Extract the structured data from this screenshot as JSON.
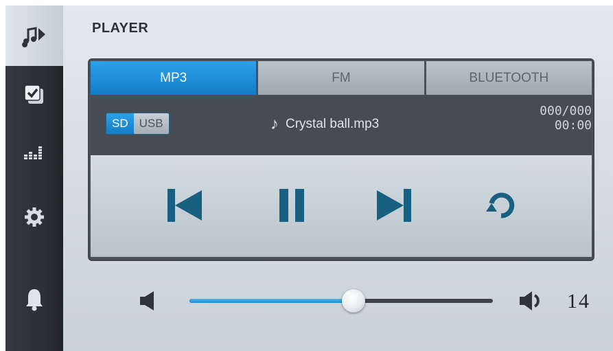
{
  "sidebar": {
    "items": [
      {
        "icon": "music-player-icon",
        "active": true
      },
      {
        "icon": "checklist-icon",
        "active": false
      },
      {
        "icon": "equalizer-icon",
        "active": false
      },
      {
        "icon": "gear-icon",
        "active": false
      },
      {
        "icon": "bell-icon",
        "active": false
      }
    ]
  },
  "header": {
    "title": "PLAYER"
  },
  "tabs": [
    {
      "label": "MP3",
      "active": true
    },
    {
      "label": "FM",
      "active": false
    },
    {
      "label": "BLUETOOTH",
      "active": false
    }
  ],
  "source": {
    "sd_label": "SD",
    "usb_label": "USB",
    "selected": "SD"
  },
  "track": {
    "name": "Crystal ball.mp3",
    "icon": "music-note-icon",
    "counter": "000/000",
    "time": "00:00"
  },
  "controls": [
    {
      "name": "previous-track",
      "icon": "skip-previous-icon"
    },
    {
      "name": "pause",
      "icon": "pause-icon"
    },
    {
      "name": "next-track",
      "icon": "skip-next-icon"
    },
    {
      "name": "repeat",
      "icon": "repeat-icon"
    }
  ],
  "volume": {
    "value": "14",
    "level_fraction": 0.54
  },
  "colors": {
    "accent": "#1e88d6",
    "icon": "#155d7d",
    "sidebar": "#2b2f33"
  }
}
